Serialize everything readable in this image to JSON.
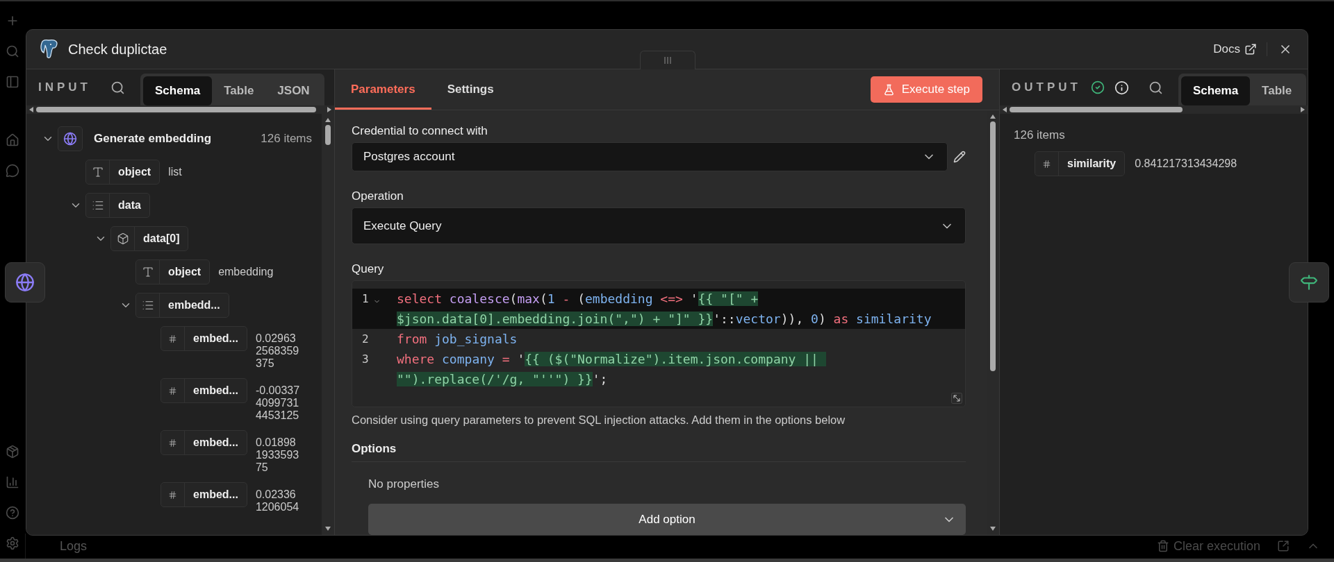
{
  "window": {
    "title": "Check duplictae",
    "docs_link": "Docs"
  },
  "input": {
    "heading": "INPUT",
    "tabs": [
      {
        "label": "Schema",
        "selected": true
      },
      {
        "label": "Table",
        "selected": false
      },
      {
        "label": "JSON",
        "selected": false
      }
    ],
    "tree": [
      {
        "kind": "source",
        "key": "Generate embedding",
        "count": "126 items",
        "expanded": true,
        "children": [
          {
            "kind": "string",
            "key": "object",
            "value": "list"
          },
          {
            "kind": "array",
            "key": "data",
            "expanded": true,
            "children": [
              {
                "kind": "object",
                "key": "data[0]",
                "expanded": true,
                "children": [
                  {
                    "kind": "string",
                    "key": "object",
                    "value": "embedding"
                  },
                  {
                    "kind": "array",
                    "key": "embedd...",
                    "expanded": true,
                    "children": [
                      {
                        "kind": "number",
                        "key": "embed...",
                        "value": "0.029632568359375"
                      },
                      {
                        "kind": "number",
                        "key": "embed...",
                        "value": "-0.0033740997314453125"
                      },
                      {
                        "kind": "number",
                        "key": "embed...",
                        "value": "0.01898193359375"
                      },
                      {
                        "kind": "number",
                        "key": "embed...",
                        "value": "0.023361206054"
                      }
                    ]
                  }
                ]
              }
            ]
          }
        ]
      }
    ]
  },
  "parameters": {
    "tabs": [
      {
        "label": "Parameters",
        "selected": true
      },
      {
        "label": "Settings",
        "selected": false
      }
    ],
    "execute_button": "Execute step",
    "credential": {
      "label": "Credential to connect with",
      "value": "Postgres account"
    },
    "operation": {
      "label": "Operation",
      "value": "Execute Query"
    },
    "query": {
      "label": "Query",
      "lines": [
        {
          "number": "1",
          "foldable": true,
          "active": true,
          "tokens": [
            {
              "kind": "keyword",
              "text": "select "
            },
            {
              "kind": "function",
              "text": "coalesce"
            },
            {
              "kind": "plain",
              "text": "("
            },
            {
              "kind": "function",
              "text": "max"
            },
            {
              "kind": "plain",
              "text": "("
            },
            {
              "kind": "number",
              "text": "1 "
            },
            {
              "kind": "operator",
              "text": "-"
            },
            {
              "kind": "plain",
              "text": " ("
            },
            {
              "kind": "identifier",
              "text": "embedding "
            },
            {
              "kind": "operator",
              "text": "<=>"
            },
            {
              "kind": "plain",
              "text": " '"
            },
            {
              "kind": "expression",
              "text": "{{ \"[\" +"
            },
            {
              "kind": "break"
            },
            {
              "kind": "expression",
              "text": "$json.data[0].embedding.join(\",\") + \"]\" }}"
            },
            {
              "kind": "plain",
              "text": "'::"
            },
            {
              "kind": "identifier",
              "text": "vector"
            },
            {
              "kind": "plain",
              "text": ")), "
            },
            {
              "kind": "number",
              "text": "0"
            },
            {
              "kind": "plain",
              "text": ") "
            },
            {
              "kind": "keyword",
              "text": "as "
            },
            {
              "kind": "identifier",
              "text": "similarity"
            }
          ]
        },
        {
          "number": "2",
          "foldable": false,
          "active": false,
          "tokens": [
            {
              "kind": "keyword",
              "text": "from "
            },
            {
              "kind": "identifier",
              "text": "job_signals"
            }
          ]
        },
        {
          "number": "3",
          "foldable": false,
          "active": false,
          "tokens": [
            {
              "kind": "keyword",
              "text": "where "
            },
            {
              "kind": "identifier",
              "text": "company "
            },
            {
              "kind": "operator",
              "text": "="
            },
            {
              "kind": "plain",
              "text": " '"
            },
            {
              "kind": "expression",
              "text": "{{ ($(\"Normalize\").item.json.company || "
            },
            {
              "kind": "break"
            },
            {
              "kind": "expression",
              "text": "\"\").replace(/'/g, \"''\") }}"
            },
            {
              "kind": "plain",
              "text": "';"
            }
          ]
        }
      ],
      "hint": "Consider using query parameters to prevent SQL injection attacks. Add them in the options below"
    },
    "options": {
      "heading": "Options",
      "empty_text": "No properties",
      "add_button": "Add option"
    }
  },
  "output": {
    "heading": "OUTPUT",
    "succeeded": true,
    "tabs": [
      {
        "label": "Schema",
        "selected": true
      },
      {
        "label": "Table",
        "selected": false
      }
    ],
    "count": "126 items",
    "fields": [
      {
        "kind": "number",
        "key": "similarity",
        "value": "0.841217313434298"
      }
    ]
  },
  "footer": {
    "logs_label": "Logs",
    "clear_button": "Clear execution"
  }
}
